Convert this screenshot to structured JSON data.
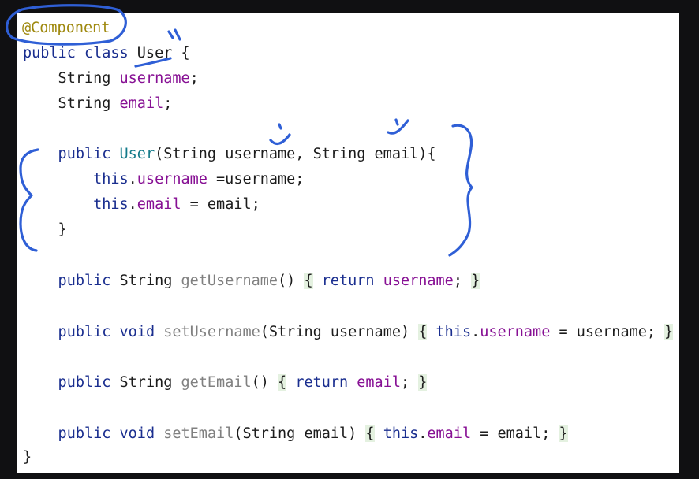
{
  "editor": {
    "lines": [
      {
        "tokens": [
          {
            "t": "@Component",
            "c": "ann"
          }
        ]
      },
      {
        "tokens": [
          {
            "t": "public class ",
            "c": "kw"
          },
          {
            "t": "User",
            "c": "plain"
          },
          {
            "t": " {",
            "c": "plain"
          }
        ]
      },
      {
        "tokens": [
          {
            "t": "    String ",
            "c": "plain"
          },
          {
            "t": "username",
            "c": "field"
          },
          {
            "t": ";",
            "c": "plain"
          }
        ]
      },
      {
        "tokens": [
          {
            "t": "    String ",
            "c": "plain"
          },
          {
            "t": "email",
            "c": "field"
          },
          {
            "t": ";",
            "c": "plain"
          }
        ]
      },
      {
        "tokens": [
          {
            "t": "    public ",
            "c": "kw"
          },
          {
            "t": "User",
            "c": "cls"
          },
          {
            "t": "(String username, String email){",
            "c": "plain"
          }
        ]
      },
      {
        "tokens": [
          {
            "t": "        this",
            "c": "kw"
          },
          {
            "t": ".",
            "c": "plain"
          },
          {
            "t": "username",
            "c": "field"
          },
          {
            "t": " =username;",
            "c": "plain"
          }
        ]
      },
      {
        "tokens": [
          {
            "t": "        this",
            "c": "kw"
          },
          {
            "t": ".",
            "c": "plain"
          },
          {
            "t": "email",
            "c": "field"
          },
          {
            "t": " = email;",
            "c": "plain"
          }
        ]
      },
      {
        "tokens": [
          {
            "t": "    }",
            "c": "plain"
          }
        ]
      },
      {
        "tokens": [
          {
            "t": "    public ",
            "c": "kw"
          },
          {
            "t": "String ",
            "c": "plain"
          },
          {
            "t": "getUsername",
            "c": "method"
          },
          {
            "t": "() ",
            "c": "plain"
          },
          {
            "t": "{",
            "c": "fold"
          },
          {
            "t": " ",
            "c": "plain"
          },
          {
            "t": "return ",
            "c": "kw"
          },
          {
            "t": "username",
            "c": "field"
          },
          {
            "t": "; ",
            "c": "plain"
          },
          {
            "t": "}",
            "c": "fold"
          }
        ]
      },
      {
        "tokens": [
          {
            "t": "    public ",
            "c": "kw"
          },
          {
            "t": "void ",
            "c": "kw"
          },
          {
            "t": "setUsername",
            "c": "method"
          },
          {
            "t": "(String username) ",
            "c": "plain"
          },
          {
            "t": "{",
            "c": "fold"
          },
          {
            "t": " ",
            "c": "plain"
          },
          {
            "t": "this",
            "c": "kw"
          },
          {
            "t": ".",
            "c": "plain"
          },
          {
            "t": "username",
            "c": "field"
          },
          {
            "t": " = username; ",
            "c": "plain"
          },
          {
            "t": "}",
            "c": "fold"
          }
        ]
      },
      {
        "tokens": [
          {
            "t": "    public ",
            "c": "kw"
          },
          {
            "t": "String ",
            "c": "plain"
          },
          {
            "t": "getEmail",
            "c": "method"
          },
          {
            "t": "() ",
            "c": "plain"
          },
          {
            "t": "{",
            "c": "fold"
          },
          {
            "t": " ",
            "c": "plain"
          },
          {
            "t": "return ",
            "c": "kw"
          },
          {
            "t": "email",
            "c": "field"
          },
          {
            "t": "; ",
            "c": "plain"
          },
          {
            "t": "}",
            "c": "fold"
          }
        ]
      },
      {
        "tokens": [
          {
            "t": "    public ",
            "c": "kw"
          },
          {
            "t": "void ",
            "c": "kw"
          },
          {
            "t": "setEmail",
            "c": "method"
          },
          {
            "t": "(String email) ",
            "c": "plain"
          },
          {
            "t": "{",
            "c": "fold"
          },
          {
            "t": " ",
            "c": "plain"
          },
          {
            "t": "this",
            "c": "kw"
          },
          {
            "t": ".",
            "c": "plain"
          },
          {
            "t": "email",
            "c": "field"
          },
          {
            "t": " = email; ",
            "c": "plain"
          },
          {
            "t": "}",
            "c": "fold"
          }
        ]
      },
      {
        "tokens": [
          {
            "t": "}",
            "c": "plain"
          }
        ]
      }
    ]
  },
  "annotations": {
    "ink_color": "#2f5fd6"
  }
}
